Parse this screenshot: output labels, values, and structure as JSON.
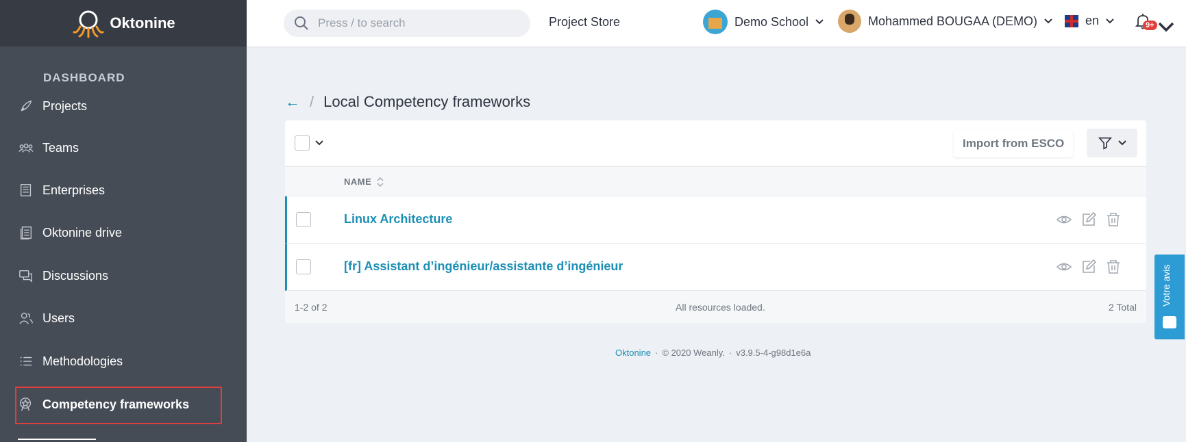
{
  "app": {
    "name": "Oktonine"
  },
  "sidebar": {
    "section_title": "DASHBOARD",
    "items": [
      {
        "label": "Projects",
        "icon": "rocket-icon"
      },
      {
        "label": "Teams",
        "icon": "team-icon"
      },
      {
        "label": "Enterprises",
        "icon": "enterprise-icon"
      },
      {
        "label": "Oktonine drive",
        "icon": "drive-icon"
      },
      {
        "label": "Discussions",
        "icon": "chat-icon"
      },
      {
        "label": "Users",
        "icon": "users-icon"
      },
      {
        "label": "Methodologies",
        "icon": "list-icon"
      },
      {
        "label": "Competency frameworks",
        "icon": "badge-icon",
        "active": true
      }
    ]
  },
  "topbar": {
    "search_placeholder": "Press / to search",
    "project_store": "Project Store",
    "school": "Demo School",
    "user": "Mohammed BOUGAA (DEMO)",
    "language": "en",
    "notifications_badge": "9+"
  },
  "breadcrumb": {
    "back": "←",
    "separator": "/",
    "title": "Local Competency frameworks"
  },
  "toolbar": {
    "import_label": "Import from ESCO"
  },
  "table": {
    "column_name": "NAME",
    "rows": [
      {
        "name": "Linux Architecture"
      },
      {
        "name": "[fr] Assistant d’ingénieur/assistante d’ingénieur"
      }
    ],
    "footer_range": "1-2 of 2",
    "footer_status": "All resources loaded.",
    "footer_total": "2 Total"
  },
  "page_footer": {
    "brand": "Oktonine",
    "copyright": "© 2020 Weanly.",
    "version": "v3.9.5-4-g98d1e6a"
  },
  "feedback": {
    "label": "Votre avis"
  },
  "colors": {
    "accent": "#1d8fb5",
    "sidebar_bg": "#464c56",
    "highlight": "#e0403b"
  }
}
